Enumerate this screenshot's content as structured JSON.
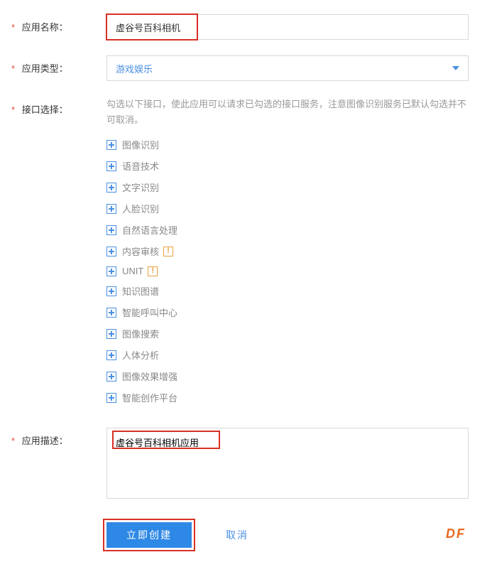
{
  "labels": {
    "app_name": "应用名称：",
    "app_type": "应用类型：",
    "api_select": "接口选择：",
    "app_desc": "应用描述："
  },
  "app_name": {
    "value": "虚谷号百科相机"
  },
  "app_type": {
    "selected": "游戏娱乐"
  },
  "api": {
    "hint": "勾选以下接口，使此应用可以请求已勾选的接口服务，注意图像识别服务已默认勾选并不可取消。",
    "items": [
      {
        "label": "图像识别",
        "warn": false
      },
      {
        "label": "语音技术",
        "warn": false
      },
      {
        "label": "文字识别",
        "warn": false
      },
      {
        "label": "人脸识别",
        "warn": false
      },
      {
        "label": "自然语言处理",
        "warn": false
      },
      {
        "label": "内容审核",
        "warn": true
      },
      {
        "label": "UNIT",
        "warn": true
      },
      {
        "label": "知识图谱",
        "warn": false
      },
      {
        "label": "智能呼叫中心",
        "warn": false
      },
      {
        "label": "图像搜索",
        "warn": false
      },
      {
        "label": "人体分析",
        "warn": false
      },
      {
        "label": "图像效果增强",
        "warn": false
      },
      {
        "label": "智能创作平台",
        "warn": false
      }
    ]
  },
  "app_desc": {
    "value": "虚谷号百科相机应用"
  },
  "buttons": {
    "create": "立即创建",
    "cancel": "取消"
  },
  "watermark": "DF",
  "colors": {
    "primary": "#2e88e5",
    "accent_blue": "#4a90e2",
    "warn": "#e8a23c",
    "highlight": "#d93025"
  }
}
